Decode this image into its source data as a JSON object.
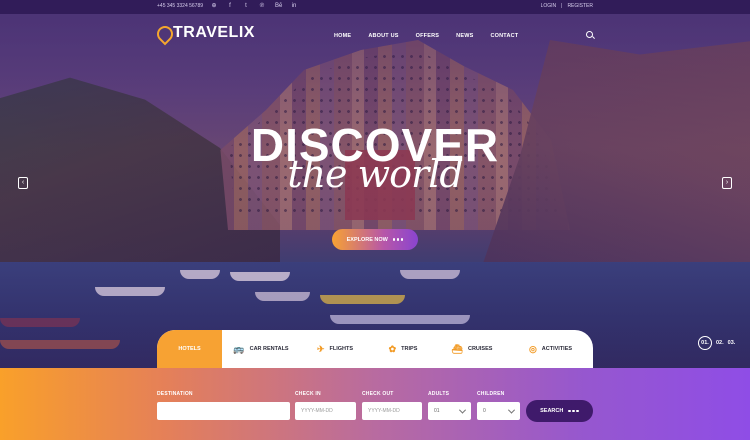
{
  "topbar": {
    "phone": "+45 345 3324 56789",
    "socials": [
      {
        "icon": "dribbble-icon",
        "glyph": "⊕"
      },
      {
        "icon": "facebook-icon",
        "glyph": "f"
      },
      {
        "icon": "twitter-icon",
        "glyph": "t"
      },
      {
        "icon": "pinterest-icon",
        "glyph": "℗"
      },
      {
        "icon": "behance-icon",
        "glyph": "Bē"
      },
      {
        "icon": "linkedin-icon",
        "glyph": "in"
      }
    ],
    "login": "LOGIN",
    "separator": "|",
    "register": "REGISTER"
  },
  "header": {
    "logo": "TRAVELIX",
    "nav": [
      "HOME",
      "ABOUT US",
      "OFFERS",
      "NEWS",
      "CONTACT"
    ]
  },
  "hero": {
    "title": "DISCOVER",
    "subtitle": "the world",
    "cta": "EXPLORE NOW",
    "pager": {
      "active": "01.",
      "items": [
        "02.",
        "03."
      ]
    }
  },
  "tabs": [
    {
      "label": "HOTELS",
      "icon": "hotel-icon",
      "glyph": "",
      "active": true
    },
    {
      "label": "CAR RENTALS",
      "icon": "bus-icon",
      "glyph": "🚌",
      "active": false
    },
    {
      "label": "FLIGHTS",
      "icon": "plane-icon",
      "glyph": "✈",
      "active": false
    },
    {
      "label": "TRIPS",
      "icon": "trips-icon",
      "glyph": "✿",
      "active": false
    },
    {
      "label": "CRUISES",
      "icon": "ship-icon",
      "glyph": "⛴",
      "active": false
    },
    {
      "label": "ACTIVITIES",
      "icon": "diving-icon",
      "glyph": "◎",
      "active": false
    }
  ],
  "search": {
    "destination_label": "DESTINATION",
    "destination_value": "",
    "checkin_label": "CHECK IN",
    "checkin_placeholder": "YYYY-MM-DD",
    "checkout_label": "CHECK OUT",
    "checkout_placeholder": "YYYY-MM-DD",
    "adults_label": "ADULTS",
    "adults_value": "01",
    "children_label": "CHILDREN",
    "children_value": "0",
    "button": "SEARCH"
  },
  "colors": {
    "accent_orange": "#f7a233",
    "accent_purple": "#8f4de6",
    "button_dark": "#3f1a6b"
  }
}
